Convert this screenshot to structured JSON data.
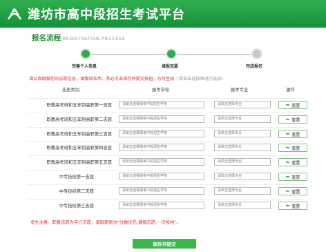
{
  "header": {
    "title": "潍坊市高中段招生考试平台",
    "logo_icon": "wheat-logo-icon"
  },
  "section": {
    "title": "报名流程",
    "subtitle": "/REGISTRATION PROCESS"
  },
  "steps": [
    {
      "label": "完善个人信息",
      "state": "done"
    },
    {
      "label": "填报志愿",
      "state": "done"
    },
    {
      "label": "完成报名",
      "state": "todo"
    }
  ],
  "notice": {
    "text": "请认真填报您的志愿信息，填报结束后，务必点击保存并提交按钮，方可生效",
    "hint": "(请单击选择框进行选择)"
  },
  "table": {
    "headers": [
      "志愿类别",
      "报考学校",
      "报考专业",
      "操作"
    ],
    "school_placeholder": "请单击选择报考中段招生学校",
    "major_placeholder": "请单击选择专业",
    "reset_label": "重置",
    "rows": [
      "职教高考班和五年制高职第一志愿",
      "职教高考班和五年制高职第二志愿",
      "职教高考班和五年制高职第三志愿",
      "职教高考班和五年制高职第四志愿",
      "职教高考班和五年制高职第五志愿",
      "中专技校第一志愿",
      "中专技校第二志愿",
      "中专技校第三志愿"
    ]
  },
  "footnote": "考生注意：职教志愿为平行志愿，录取原则为\"分数优先,遵循志愿,一次投档\"。",
  "submit_label": "保存并提交",
  "colors": {
    "brand_green": "#2fae4f",
    "alert_red": "#e03030"
  }
}
